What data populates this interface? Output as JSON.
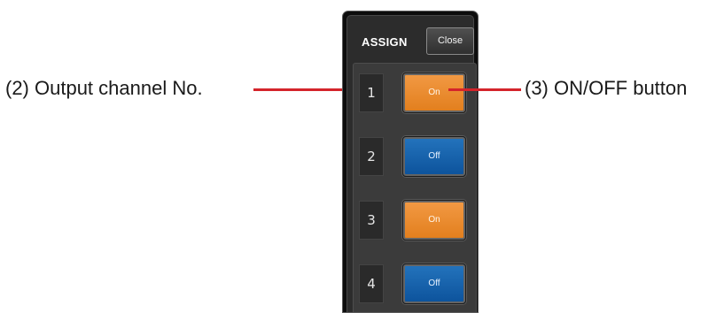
{
  "callouts": {
    "output_channel": "(2) Output channel No.",
    "onoff_button": "(3) ON/OFF button"
  },
  "colors": {
    "leader_line": "#d4242b",
    "on": "#e88a2c",
    "off": "#1766ad"
  },
  "panel": {
    "title": "ASSIGN",
    "close_label": "Close",
    "channels": [
      {
        "number": "1",
        "state": "On"
      },
      {
        "number": "2",
        "state": "Off"
      },
      {
        "number": "3",
        "state": "On"
      },
      {
        "number": "4",
        "state": "Off"
      }
    ]
  }
}
